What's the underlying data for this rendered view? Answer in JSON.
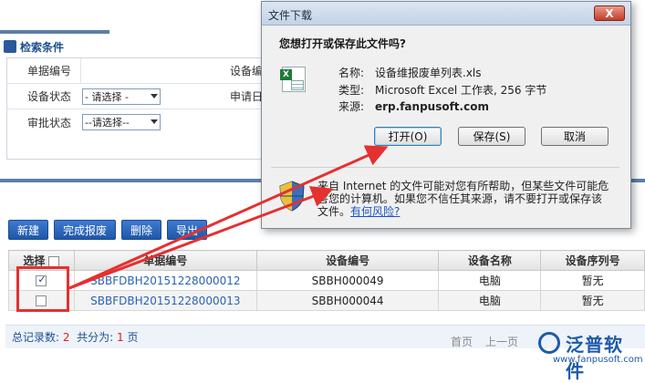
{
  "search": {
    "title": "检索条件",
    "fields": [
      {
        "label": "单据编号",
        "value": ""
      },
      {
        "label": "设备状态",
        "value": "- 请选择 -"
      },
      {
        "label": "审批状态",
        "value": "--请选择--"
      }
    ],
    "right_labels": [
      "设备编",
      "申请日"
    ]
  },
  "toolbar": {
    "buttons": [
      "新建",
      "完成报废",
      "删除",
      "导出"
    ]
  },
  "table": {
    "headers": [
      "选择",
      "单据编号",
      "设备编号",
      "设备名称",
      "设备序列号"
    ],
    "rows": [
      {
        "checked": true,
        "code": "SBBFDBH20151228000012",
        "device_no": "SBBH000049",
        "device_name": "电脑",
        "serial": "暂无"
      },
      {
        "checked": false,
        "code": "SBBFDBH20151228000013",
        "device_no": "SBBH000044",
        "device_name": "电脑",
        "serial": "暂无"
      }
    ]
  },
  "footer": {
    "total_label": "总记录数:",
    "total_value": "2",
    "pages_label": "共分为:",
    "pages_value": "1",
    "pages_unit": "页",
    "pager": [
      "首页",
      "上一页"
    ]
  },
  "dialog": {
    "title": "文件下载",
    "close": "X",
    "question": "您想打开或保存此文件吗?",
    "name_label": "名称:",
    "name_value": "设备维报废单列表.xls",
    "type_label": "类型:",
    "type_value": "Microsoft Excel 工作表, 256 字节",
    "source_label": "来源:",
    "source_value": "erp.fanpusoft.com",
    "open_button": "打开(O)",
    "save_button": "保存(S)",
    "cancel_button": "取消",
    "warning_text": "来自 Internet 的文件可能对您有所帮助，但某些文件可能危害您的计算机。如果您不信任其来源，请不要打开或保存该文件。",
    "risk_link": "有何风险?"
  },
  "watermark": {
    "brand": "泛普软件",
    "url": "www.fanpusoft.com"
  },
  "colors": {
    "accent": "#1f4f8f",
    "highlight": "#e53030",
    "link": "#2a62b3"
  }
}
